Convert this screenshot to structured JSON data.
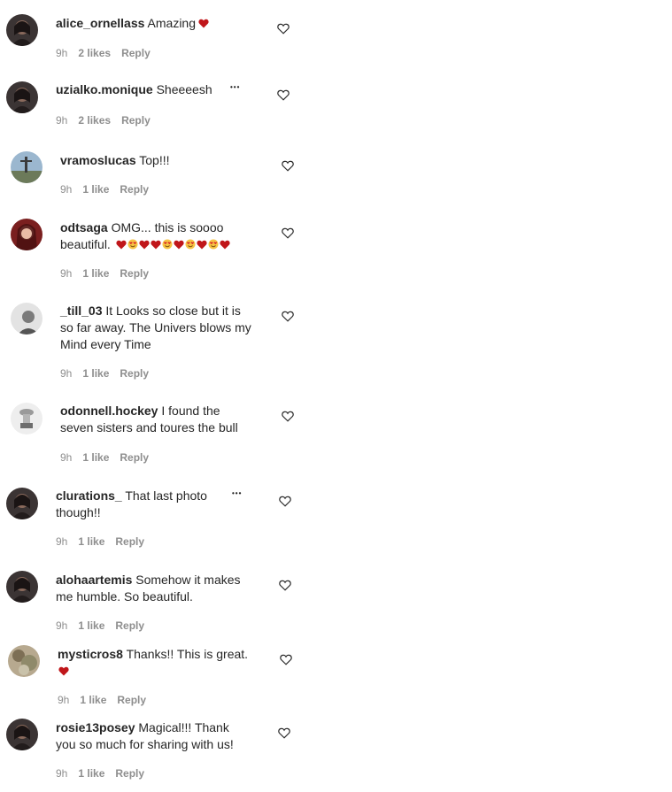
{
  "comments": [
    {
      "username": "alice_ornellass",
      "text": "Amazing",
      "emoji": [
        "heart"
      ],
      "time": "9h",
      "likes": "2 likes",
      "reply": "Reply",
      "avatar": "dark-portrait",
      "more": false
    },
    {
      "username": "uzialko.monique",
      "text": "Sheeeesh",
      "emoji": [],
      "time": "9h",
      "likes": "2 likes",
      "reply": "Reply",
      "avatar": "dark-portrait",
      "more": true
    },
    {
      "username": "vramoslucas",
      "text": "Top!!!",
      "emoji": [],
      "time": "9h",
      "likes": "1 like",
      "reply": "Reply",
      "avatar": "landscape",
      "more": false
    },
    {
      "username": "odtsaga",
      "text": "OMG... this is soooo beautiful.",
      "emoji": [
        "heart",
        "smile-hearts",
        "heart",
        "heart",
        "smile-hearts",
        "heart",
        "smile-hearts",
        "heart",
        "smile-hearts",
        "heart"
      ],
      "time": "9h",
      "likes": "1 like",
      "reply": "Reply",
      "avatar": "red-portrait",
      "more": false
    },
    {
      "username": "_till_03",
      "text": "It Looks so close but it is so far away. The Univers blows my Mind every Time",
      "emoji": [],
      "time": "9h",
      "likes": "1 like",
      "reply": "Reply",
      "avatar": "gray-portrait",
      "more": false
    },
    {
      "username": "odonnell.hockey",
      "text": "I found the seven sisters and toures the bull",
      "emoji": [],
      "time": "9h",
      "likes": "1 like",
      "reply": "Reply",
      "avatar": "trophy",
      "more": false
    },
    {
      "username": "clurations_",
      "text": "That last photo though!!",
      "emoji": [],
      "time": "9h",
      "likes": "1 like",
      "reply": "Reply",
      "avatar": "dark-portrait",
      "more": true
    },
    {
      "username": "alohaartemis",
      "text": "Somehow it makes me humble. So beautiful.",
      "emoji": [],
      "time": "9h",
      "likes": "1 like",
      "reply": "Reply",
      "avatar": "dark-portrait",
      "more": false
    },
    {
      "username": "mysticros8",
      "text": "Thanks!! This is great.",
      "emoji": [
        "heart"
      ],
      "time": "9h",
      "likes": "1 like",
      "reply": "Reply",
      "avatar": "nature",
      "more": false
    },
    {
      "username": "rosie13posey",
      "text": "Magical!!! Thank you so much for sharing with us!",
      "emoji": [],
      "time": "9h",
      "likes": "1 like",
      "reply": "Reply",
      "avatar": "dark-portrait",
      "more": false
    }
  ],
  "colors": {
    "heart": "#c0161a",
    "meta": "#8e8e8e",
    "text": "#262626"
  },
  "icons": {
    "like": "heart-outline-icon",
    "more": "more-dots-icon"
  }
}
